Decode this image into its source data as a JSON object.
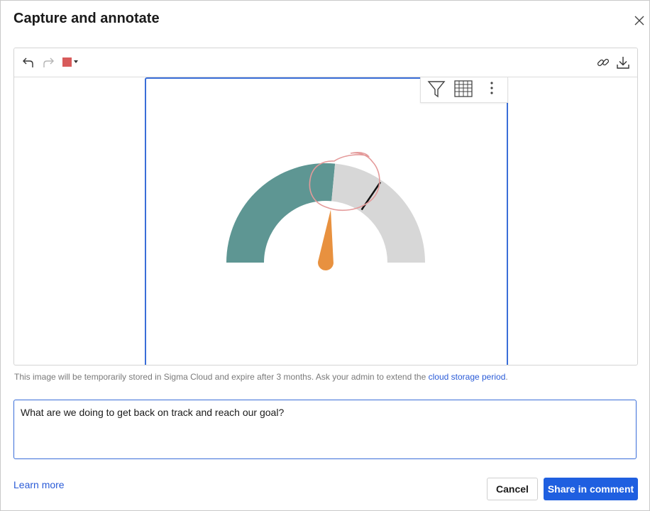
{
  "dialog": {
    "title": "Capture and annotate",
    "close_icon": "close-icon"
  },
  "toolbar": {
    "undo_icon": "undo-icon",
    "redo_icon": "redo-icon",
    "color_swatch": "#d85b5b",
    "link_icon": "link-icon",
    "download_icon": "download-icon"
  },
  "viz_toolbar": {
    "filter_icon": "filter-icon",
    "table_icon": "table-icon",
    "more_icon": "more-vertical-icon"
  },
  "gauge": {
    "value_fraction": 0.53,
    "target_fraction": 0.69,
    "fill_color": "#5e9693",
    "track_color": "#d7d7d7",
    "needle_color": "#e8913f",
    "target_color": "#111111",
    "annotation_color": "#e49a9a"
  },
  "storage_note": {
    "text": "This image will be temporarily stored in Sigma Cloud and expire after 3 months. Ask your admin to extend the ",
    "link": "cloud storage period",
    "suffix": "."
  },
  "comment": {
    "value": "What are we doing to get back on track and reach our goal?"
  },
  "footer": {
    "learn_more": "Learn more",
    "cancel": "Cancel",
    "share": "Share in comment"
  }
}
